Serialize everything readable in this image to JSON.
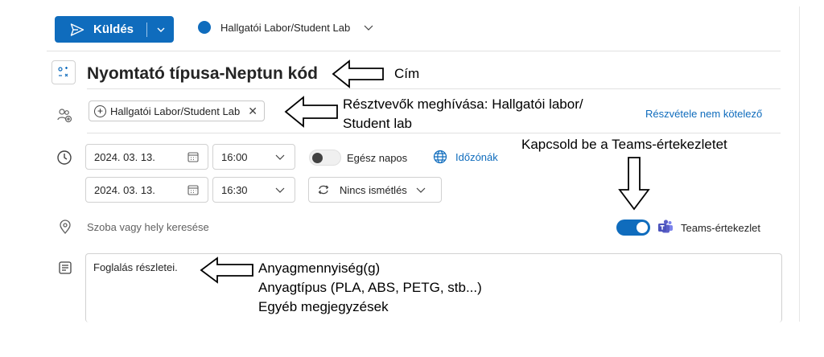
{
  "toolbar": {
    "send_label": "Küldés",
    "calendar_name": "Hallgatói Labor/Student Lab",
    "calendar_color": "#0f6cbd"
  },
  "event": {
    "title": "Nyomtató típusa-Neptun kód"
  },
  "attendees": {
    "chip_label": "Hallgatói Labor/Student Lab",
    "optional_link": "Részvétele nem kötelező"
  },
  "datetime": {
    "start_date": "2024. 03. 13.",
    "start_time": "16:00",
    "end_date": "2024. 03. 13.",
    "end_time": "16:30",
    "all_day_label": "Egész napos",
    "all_day_on": false,
    "timezone_link": "Időzónák",
    "repeat_label": "Nincs ismétlés"
  },
  "location": {
    "placeholder": "Szoba vagy hely keresése",
    "teams_on": true,
    "teams_label": "Teams-értekezlet"
  },
  "body": {
    "text": "Foglalás részletei."
  },
  "annotations": {
    "title_note": "Cím",
    "attendee_note_line1": "Résztvevők meghívása: Hallgatói labor/",
    "attendee_note_line2": "Student lab",
    "teams_note": "Kapcsold be a Teams-értekezletet",
    "body_note_line1": "Anyagmennyiség(g)",
    "body_note_line2": "Anyagtípus (PLA, ABS, PETG, stb...)",
    "body_note_line3": "Egyéb megjegyzések"
  },
  "colors": {
    "accent": "#0f6cbd",
    "teams_purple": "#5b5fc7"
  }
}
